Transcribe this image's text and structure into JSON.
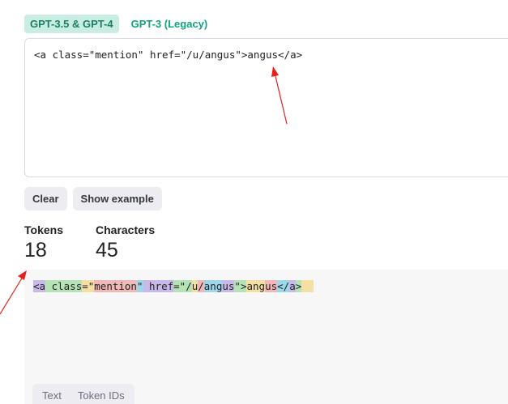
{
  "model_tabs": [
    {
      "label": "GPT-3.5 & GPT-4",
      "active": true
    },
    {
      "label": "GPT-3 (Legacy)",
      "active": false
    }
  ],
  "input": {
    "value": "<a class=\"mention\" href=\"/u/angus\">angus</a>"
  },
  "buttons": {
    "clear_label": "Clear",
    "example_label": "Show example"
  },
  "stats": {
    "tokens_label": "Tokens",
    "tokens_value": "18",
    "characters_label": "Characters",
    "characters_value": "45"
  },
  "tokens": [
    {
      "text": "<a",
      "color": "#c8b9ea"
    },
    {
      "text": " class",
      "color": "#b6e3b6"
    },
    {
      "text": "=\"",
      "color": "#f6dfa4"
    },
    {
      "text": "mention",
      "color": "#f1b8b8"
    },
    {
      "text": "\"",
      "color": "#9fd7ea"
    },
    {
      "text": " href",
      "color": "#c8b9ea"
    },
    {
      "text": "=\"/",
      "color": "#b6e3b6"
    },
    {
      "text": "u",
      "color": "#f6dfa4"
    },
    {
      "text": "/",
      "color": "#f1b8b8"
    },
    {
      "text": "ang",
      "color": "#9fd7ea"
    },
    {
      "text": "us",
      "color": "#c8b9ea"
    },
    {
      "text": "\">",
      "color": "#b6e3b6"
    },
    {
      "text": "ang",
      "color": "#f6dfa4"
    },
    {
      "text": "us",
      "color": "#f1b8b8"
    },
    {
      "text": "</",
      "color": "#9fd7ea"
    },
    {
      "text": "a",
      "color": "#c8b9ea"
    },
    {
      "text": ">",
      "color": "#b6e3b6"
    },
    {
      "text": "",
      "color": "#f6dfa4"
    }
  ],
  "view_tabs": [
    {
      "label": "Text"
    },
    {
      "label": "Token IDs"
    }
  ],
  "colors": {
    "accent": "#10a37f",
    "annotation_arrow": "#e8201c"
  }
}
